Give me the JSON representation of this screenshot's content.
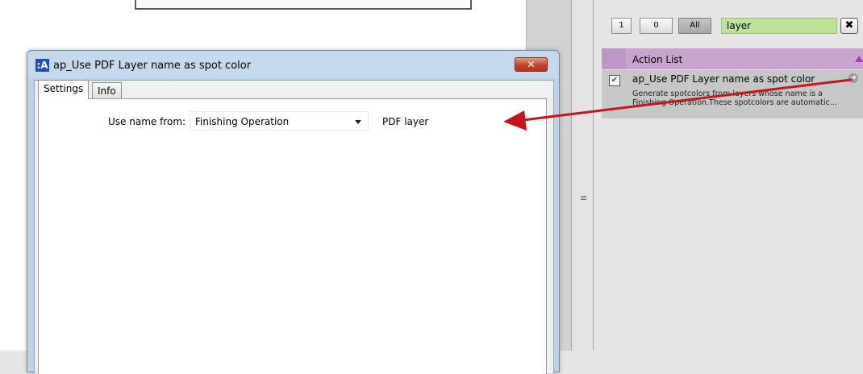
{
  "background": {
    "accent_arrow_color": "#c4161c"
  },
  "right_panel": {
    "filters": {
      "one": "1",
      "zero": "0",
      "all": "All"
    },
    "search": {
      "value": "layer"
    },
    "clear_icon": "✖",
    "action_list": {
      "title": "Action List",
      "items": [
        {
          "checked": true,
          "check_glyph": "✔",
          "title": "ap_Use PDF Layer name as spot color",
          "description_line1": "Generate spotcolors from layers whose name is a",
          "description_line2": "Finishing Operation.These spotcolors are automatic...",
          "go_icon": "➜"
        }
      ]
    }
  },
  "dialog": {
    "app_icon": ":A",
    "title": "ap_Use PDF Layer name as spot color",
    "close_icon": "✕",
    "tabs": [
      {
        "label": "Settings",
        "active": true
      },
      {
        "label": "Info",
        "active": false
      }
    ],
    "settings": {
      "use_name_label": "Use name from:",
      "use_name_value": "Finishing Operation",
      "pdf_layer_label": "PDF layer"
    }
  },
  "splitter": {
    "grip": "≡"
  }
}
